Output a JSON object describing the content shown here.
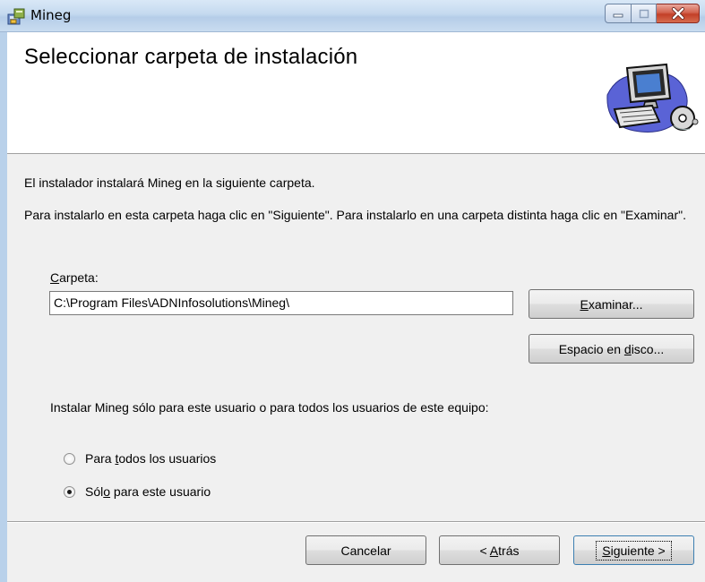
{
  "window": {
    "title": "Mineg"
  },
  "header": {
    "title": "Seleccionar carpeta de instalación"
  },
  "body": {
    "intro": "El instalador instalará Mineg en la siguiente carpeta.",
    "instructions": "Para instalarlo en esta carpeta haga clic en \"Siguiente\". Para instalarlo en una carpeta distinta haga clic en \"Examinar\".",
    "folder_label_pre": "",
    "folder_label_mnemonic": "C",
    "folder_label_post": "arpeta:",
    "folder_value": "C:\\Program Files\\ADNInfosolutions\\Mineg\\",
    "browse_mnemonic": "E",
    "browse_post": "xaminar...",
    "disk_pre": "Espacio en ",
    "disk_mnemonic": "d",
    "disk_post": "isco...",
    "scope_prompt": "Instalar Mineg sólo para este usuario o para todos los usuarios de este equipo:",
    "radio_all_pre": "Para ",
    "radio_all_mnemonic": "t",
    "radio_all_post": "odos los usuarios",
    "radio_me_pre": "Sól",
    "radio_me_mnemonic": "o",
    "radio_me_post": " para este usuario",
    "selected_option": "me"
  },
  "footer": {
    "cancel": "Cancelar",
    "back_pre": "< ",
    "back_mnemonic": "A",
    "back_post": "trás",
    "next_mnemonic": "S",
    "next_post": "iguiente >"
  },
  "colors": {
    "titlebar": "#c4d9ef",
    "close_button": "#c33f27",
    "dialog_bg": "#f0f0f0"
  },
  "icons": [
    "installer-app-icon",
    "computer-setup-graphic",
    "minimize-icon",
    "maximize-icon",
    "close-icon"
  ]
}
